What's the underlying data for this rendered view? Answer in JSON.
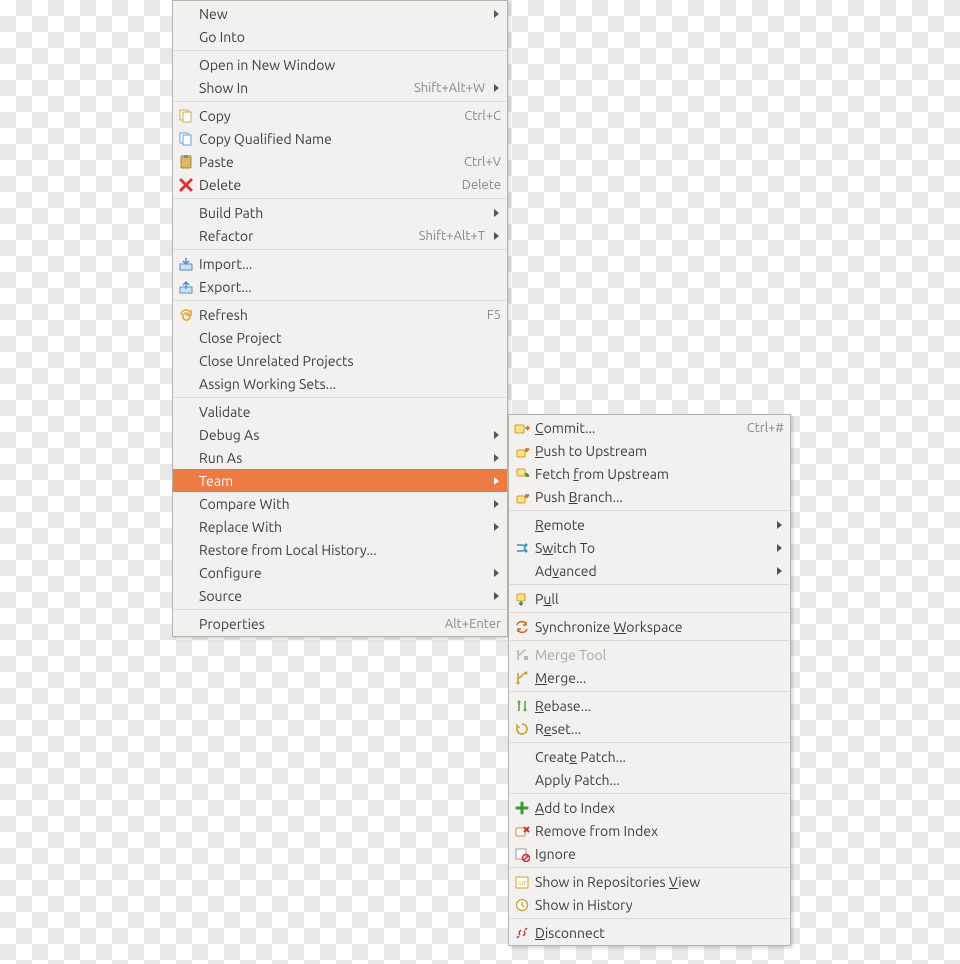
{
  "menu": {
    "groups": [
      [
        {
          "name": "menu-new",
          "label": "New",
          "submenu": true
        },
        {
          "name": "menu-go-into",
          "label": "Go Into"
        }
      ],
      [
        {
          "name": "menu-open-new-window",
          "label": "Open in New Window"
        },
        {
          "name": "menu-show-in",
          "label": "Show In",
          "accel": "Shift+Alt+W",
          "submenu": true
        }
      ],
      [
        {
          "name": "menu-copy",
          "icon": "copy",
          "label": "Copy",
          "accel": "Ctrl+C"
        },
        {
          "name": "menu-copy-qname",
          "icon": "copy-qual",
          "label": "Copy Qualified Name"
        },
        {
          "name": "menu-paste",
          "icon": "paste",
          "label": "Paste",
          "accel": "Ctrl+V"
        },
        {
          "name": "menu-delete",
          "icon": "delete",
          "label": "Delete",
          "accel": "Delete"
        }
      ],
      [
        {
          "name": "menu-build-path",
          "label": "Build Path",
          "submenu": true
        },
        {
          "name": "menu-refactor",
          "label": "Refactor",
          "accel": "Shift+Alt+T",
          "submenu": true
        }
      ],
      [
        {
          "name": "menu-import",
          "icon": "import",
          "label": "Import..."
        },
        {
          "name": "menu-export",
          "icon": "export",
          "label": "Export..."
        }
      ],
      [
        {
          "name": "menu-refresh",
          "icon": "refresh",
          "label": "Refresh",
          "accel": "F5"
        },
        {
          "name": "menu-close-proj",
          "label": "Close Project"
        },
        {
          "name": "menu-close-unrel",
          "label": "Close Unrelated Projects"
        },
        {
          "name": "menu-assign-ws",
          "label": "Assign Working Sets..."
        }
      ],
      [
        {
          "name": "menu-validate",
          "label": "Validate"
        },
        {
          "name": "menu-debug-as",
          "label": "Debug As",
          "submenu": true
        },
        {
          "name": "menu-run-as",
          "label": "Run As",
          "submenu": true
        },
        {
          "name": "menu-team",
          "label": "Team",
          "submenu": true,
          "selected": true
        },
        {
          "name": "menu-compare-with",
          "label": "Compare With",
          "submenu": true
        },
        {
          "name": "menu-replace-with",
          "label": "Replace With",
          "submenu": true
        },
        {
          "name": "menu-restore-hist",
          "label": "Restore from Local History..."
        },
        {
          "name": "menu-configure",
          "label": "Configure",
          "submenu": true
        },
        {
          "name": "menu-source",
          "label": "Source",
          "submenu": true
        }
      ],
      [
        {
          "name": "menu-properties",
          "label": "Properties",
          "accel": "Alt+Enter"
        }
      ]
    ]
  },
  "submenu": {
    "groups": [
      [
        {
          "name": "team-commit",
          "icon": "git-commit",
          "label": "Commit...",
          "ul": 0,
          "accel": "Ctrl+#"
        },
        {
          "name": "team-push-up",
          "icon": "git-push",
          "label": "Push to Upstream",
          "ul": 0
        },
        {
          "name": "team-fetch-up",
          "icon": "git-fetch",
          "label": "Fetch from Upstream",
          "ul": 6
        },
        {
          "name": "team-push-branch",
          "icon": "git-push",
          "label": "Push Branch...",
          "ul": 5
        }
      ],
      [
        {
          "name": "team-remote",
          "label": "Remote",
          "ul": 0,
          "submenu": true
        },
        {
          "name": "team-switch-to",
          "icon": "git-switch",
          "label": "Switch To",
          "ul": 1,
          "submenu": true
        },
        {
          "name": "team-advanced",
          "label": "Advanced",
          "ul": 2,
          "submenu": true
        }
      ],
      [
        {
          "name": "team-pull",
          "icon": "git-pull",
          "label": "Pull",
          "ul": 1
        }
      ],
      [
        {
          "name": "team-sync-ws",
          "icon": "git-sync",
          "label": "Synchronize Workspace",
          "ul": 12
        }
      ],
      [
        {
          "name": "team-merge-tool",
          "icon": "git-merge-tool",
          "label": "Merge Tool",
          "disabled": true
        },
        {
          "name": "team-merge",
          "icon": "git-merge",
          "label": "Merge...",
          "ul": 0
        }
      ],
      [
        {
          "name": "team-rebase",
          "icon": "git-rebase",
          "label": "Rebase...",
          "ul": 0
        },
        {
          "name": "team-reset",
          "icon": "git-reset",
          "label": "Reset...",
          "ul": 1
        }
      ],
      [
        {
          "name": "team-create-patch",
          "label": "Create Patch...",
          "ul": 5
        },
        {
          "name": "team-apply-patch",
          "label": "Apply Patch..."
        }
      ],
      [
        {
          "name": "team-add-index",
          "icon": "git-add",
          "label": "Add to Index",
          "ul": 0
        },
        {
          "name": "team-rm-index",
          "icon": "git-remove",
          "label": "Remove from Index"
        },
        {
          "name": "team-ignore",
          "icon": "git-ignore",
          "label": "Ignore"
        }
      ],
      [
        {
          "name": "team-show-repos",
          "icon": "git-repo",
          "label": "Show in Repositories View",
          "ul": 21
        },
        {
          "name": "team-show-hist",
          "icon": "git-history",
          "label": "Show in History"
        }
      ],
      [
        {
          "name": "team-disconnect",
          "icon": "git-disconnect",
          "label": "Disconnect",
          "ul": 0
        }
      ]
    ]
  }
}
